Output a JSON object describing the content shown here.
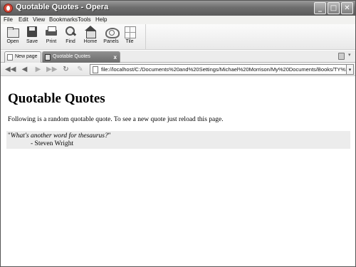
{
  "window": {
    "title": "Quotable Quotes - Opera",
    "controls": {
      "minimize": "_",
      "maximize": "□",
      "close": "✕"
    }
  },
  "menu": [
    "File",
    "Edit",
    "View",
    "Bookmarks",
    "Tools",
    "Help"
  ],
  "toolbar": {
    "buttons": [
      {
        "label": "Open",
        "icon": "open-icon"
      },
      {
        "label": "Save",
        "icon": "save-icon"
      },
      {
        "label": "Print",
        "icon": "print-icon"
      },
      {
        "label": "Find",
        "icon": "find-icon"
      },
      {
        "label": "Home",
        "icon": "home-icon"
      },
      {
        "label": "Panels",
        "icon": "panels-icon"
      },
      {
        "label": "Tile",
        "icon": "tile-icon"
      }
    ]
  },
  "tabs": [
    {
      "label": "New page",
      "active": false
    },
    {
      "label": "Quotable Quotes",
      "active": true,
      "close": "x"
    }
  ],
  "navigation": {
    "buttons": [
      "rewind-icon",
      "back-icon",
      "forward-icon",
      "fast-forward-icon",
      "reload-icon",
      "edit-icon"
    ],
    "address": "file://localhost/C:/Documents%20and%20Settings/Michael%20Morrison/My%20Documents/Books/TY%20HTML%..."
  },
  "page": {
    "heading": "Quotable Quotes",
    "intro": "Following is a random quotable quote. To see a new quote just reload this page.",
    "quote_open": "\"",
    "quote": "What's another word for thesaurus?",
    "quote_close": "\"",
    "author": "- Steven Wright"
  }
}
